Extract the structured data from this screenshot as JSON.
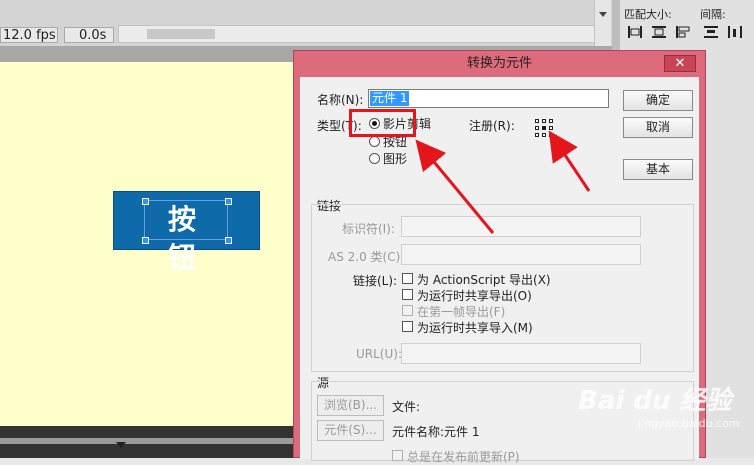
{
  "timeline": {
    "fps": "12.0 fps",
    "time": "0.0s"
  },
  "align_panel": {
    "match_size_label": "匹配大小:",
    "spacing_label": "间隔:"
  },
  "stage": {
    "button_text": "按 钮"
  },
  "dialog": {
    "title": "转换为元件",
    "close_glyph": "✕",
    "name_label": "名称(N):",
    "name_value": "元件 1",
    "type_label": "类型(T):",
    "type_options": [
      "影片剪辑",
      "按钮",
      "图形"
    ],
    "selected_type": "影片剪辑",
    "registration_label": "注册(R):",
    "ok_label": "确定",
    "cancel_label": "取消",
    "basic_label": "基本",
    "linkage": {
      "section_label": "链接",
      "identifier_label": "标识符(I):",
      "as2_class_label": "AS 2.0 类(C):",
      "linkage_label": "链接(L):",
      "options": [
        {
          "label": "为 ActionScript 导出(X)",
          "checked": false,
          "enabled": true
        },
        {
          "label": "为运行时共享导出(O)",
          "checked": false,
          "enabled": true
        },
        {
          "label": "在第一帧导出(F)",
          "checked": false,
          "enabled": false
        },
        {
          "label": "为运行时共享导入(M)",
          "checked": false,
          "enabled": true
        }
      ],
      "url_label": "URL(U):"
    },
    "source": {
      "section_label": "源",
      "browse_label": "浏览(B)...",
      "file_label": "文件:",
      "symbol_button_label": "元件(S)...",
      "symbol_name_label": "元件名称:元件 1",
      "always_update_label": "总是在发布前更新(P)"
    }
  },
  "annotation": {
    "highlight_color": "#e4161b",
    "arrow_color": "#e4161b"
  },
  "watermark": {
    "brand": "Bai du 经验",
    "url": "jingyan.baidu.com"
  }
}
